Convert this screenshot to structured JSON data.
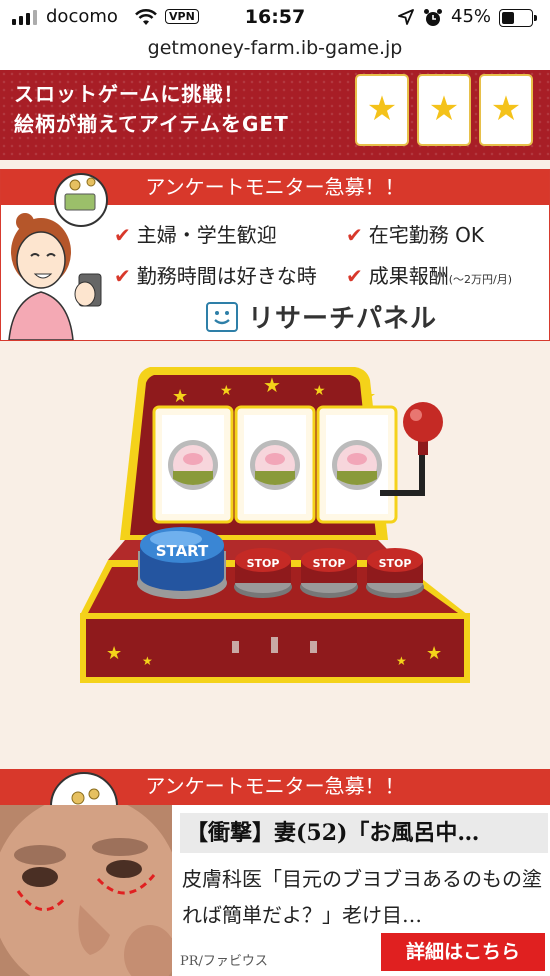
{
  "status_bar": {
    "carrier": "docomo",
    "vpn": "VPN",
    "time": "16:57",
    "battery": "45%",
    "battery_level": 0.45
  },
  "url": "getmoney-farm.ib-game.jp",
  "slot_banner": {
    "line1": "スロットゲームに挑戦！",
    "line2": "絵柄が揃えてアイテムをGET",
    "star_glyph": "★"
  },
  "ad_survey": {
    "header": "アンケートモニター急募！！",
    "items": [
      {
        "label": "主婦・学生歓迎"
      },
      {
        "label": "在宅勤務 OK"
      },
      {
        "label": "勤務時間は好きな時"
      },
      {
        "label": "成果報酬",
        "note": "(～2万円/月)"
      }
    ],
    "check_glyph": "✔",
    "brand": "リサーチパネル"
  },
  "slot_machine": {
    "start_label": "START",
    "stop_labels": [
      "STOP",
      "STOP",
      "STOP"
    ],
    "colors": {
      "body": "#8f1a1c",
      "trim": "#f4d21a",
      "start": "#2f73c4",
      "stop": "#c52a25"
    }
  },
  "ad_survey_2": {
    "header": "アンケートモニター急募！！"
  },
  "bottom_ad": {
    "title": "【衝撃】妻(52)「お風呂中…",
    "body": "皮膚科医「目元のブヨブヨあるのもの塗れば簡単だよ？」老け目…",
    "sponsor": "PR/ファビウス",
    "button": "詳細はこちら"
  }
}
